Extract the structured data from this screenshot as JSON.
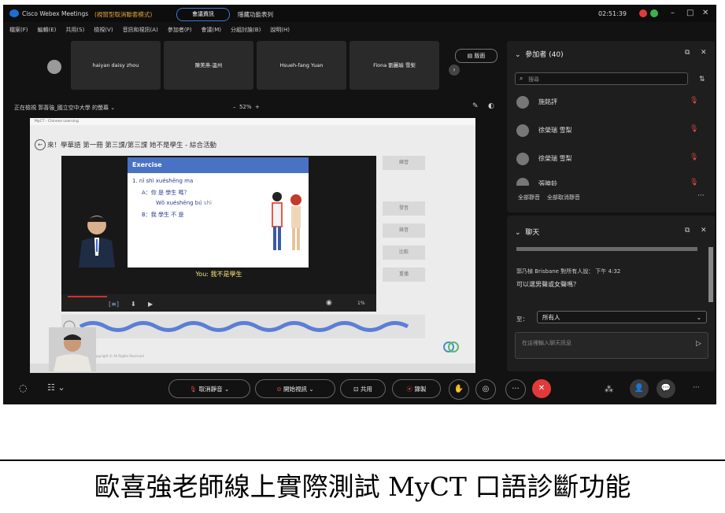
{
  "window": {
    "title": "Cisco Webex Meetings",
    "mode": "(視窗型取消聯套模式)",
    "meeting_info_button": "會議資訊",
    "app_menu": "隱藏功能表列",
    "clock": "02:51:39"
  },
  "menu": [
    "檔案(F)",
    "編輯(E)",
    "共用(S)",
    "檢視(V)",
    "音訊和視訊(A)",
    "參加者(P)",
    "會議(M)",
    "分組討論(B)",
    "說明(H)"
  ],
  "thumbnails": [
    "haiyan daisy zhou",
    "陳美燕-溫州",
    "Hsueh-fang Yuan",
    "Fiona 劉麗瑜 雪梨"
  ],
  "layout_button": "版面",
  "share_label": "正在檢視 郭喜強_國立空中大學 的螢幕",
  "zoom_level": "52%",
  "shared_screen": {
    "window_title": "MyCT - Chinese Learning",
    "lesson_title": "來！學華語 第一冊 第三課/第三課 她不是學生 - 綜合活動",
    "slide_heading": "Exercise",
    "line1": "1.      nǐ shì xuéshēng ma",
    "line2": "A：你 是 學生 嗎？",
    "line3": "Wǒ xuéshēng bú shì",
    "line4": "B：我  學生  不 是",
    "caption": "You: 我不是學生",
    "percent": "1%",
    "side_buttons": [
      "練習",
      "發音",
      "錄音",
      "比較",
      "重播"
    ],
    "copyright": "Copyright © All Rights Reserved"
  },
  "participants": {
    "header": "參加者 (40)",
    "search_placeholder": "搜尋",
    "list": [
      "施銘評",
      "徐榮瑞 雪梨",
      "徐榮瑞 雪梨",
      "張曉鈴"
    ],
    "mute_all": "全部靜音",
    "unmute_all": "全部取消靜音"
  },
  "chat": {
    "header": "聊天",
    "msg_header": "郭乃楨 Brisbane 對所有人說：   下午 4:32",
    "msg_text": "可以選男聲或女聲嗎？",
    "to_label": "至：",
    "to_value": "所有人",
    "input_placeholder": "在這裡輸入聊天訊息"
  },
  "controls": {
    "unmute": "取消靜音",
    "start_video": "開始視訊",
    "share": "共用",
    "record": "錄製"
  },
  "colors": {
    "end_button": "#e23a3a",
    "accent": "#1b6fd0",
    "mute_icon": "#e04848"
  },
  "photo_caption": "歐喜強老師線上實際測試 MyCT 口語診斷功能"
}
